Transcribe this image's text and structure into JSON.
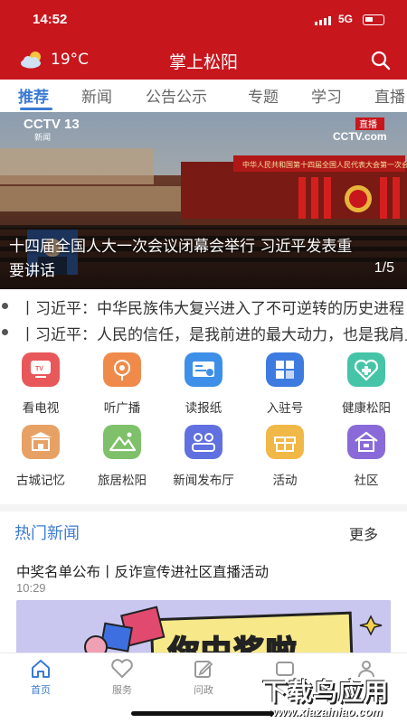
{
  "status": {
    "time": "14:52",
    "network": "5G"
  },
  "appbar": {
    "temperature": "19°C",
    "title": "掌上松阳",
    "weather_icon": "partly-cloudy-icon",
    "search_icon": "search-icon"
  },
  "tabs": [
    "推荐",
    "新闻",
    "公告公示",
    "专题",
    "学习",
    "直播"
  ],
  "banner": {
    "caption": "十四届全国人大一次会议闭幕会举行 习近平发表重要讲话",
    "page": "1/5",
    "channel_logo": "CCTV 13",
    "channel_sub": "新闻",
    "live_tag": "直播",
    "site_tag": "CCTV.com",
    "stage_banner": "中华人民共和国第十四届全国人民代表大会第一次会议"
  },
  "ticker": [
    "丨习近平：中华民族伟大复兴进入了不可逆转的历史进程",
    "丨习近平：人民的信任，是我前进的最大动力，也是我肩上沉甸甸的责任"
  ],
  "grid": [
    {
      "label": "看电视",
      "icon": "tv-icon",
      "color": "#e8585a"
    },
    {
      "label": "听广播",
      "icon": "radio-icon",
      "color": "#f08a4b"
    },
    {
      "label": "读报纸",
      "icon": "newspaper-icon",
      "color": "#3d8fe8"
    },
    {
      "label": "入驻号",
      "icon": "apps-icon",
      "color": "#3d7be0"
    },
    {
      "label": "健康松阳",
      "icon": "health-icon",
      "color": "#45c4a8"
    },
    {
      "label": "古城记忆",
      "icon": "ancient-city-icon",
      "color": "#e8a165"
    },
    {
      "label": "旅居松阳",
      "icon": "mountain-icon",
      "color": "#7fc06a"
    },
    {
      "label": "新闻发布厅",
      "icon": "press-room-icon",
      "color": "#6170e0"
    },
    {
      "label": "活动",
      "icon": "gift-icon",
      "color": "#f0b846"
    },
    {
      "label": "社区",
      "icon": "community-icon",
      "color": "#8a6ad8"
    }
  ],
  "hot_news": {
    "title": "热门新闻",
    "more": "更多",
    "item_title": "中奖名单公布丨反诈宣传进社区直播活动",
    "item_time": "10:29",
    "thumb_text": "你中奖啦"
  },
  "bottom_nav": [
    {
      "label": "首页",
      "icon": "home-icon"
    },
    {
      "label": "服务",
      "icon": "heart-icon"
    },
    {
      "label": "问政",
      "icon": "edit-icon"
    },
    {
      "label": "",
      "icon": "media-icon"
    },
    {
      "label": "",
      "icon": "user-icon"
    }
  ],
  "watermark": {
    "main": "下载鸟应用",
    "url": "www.xiazainiao.com"
  },
  "colors": {
    "brand_red": "#c8161d",
    "accent_blue": "#3a7bd5"
  }
}
